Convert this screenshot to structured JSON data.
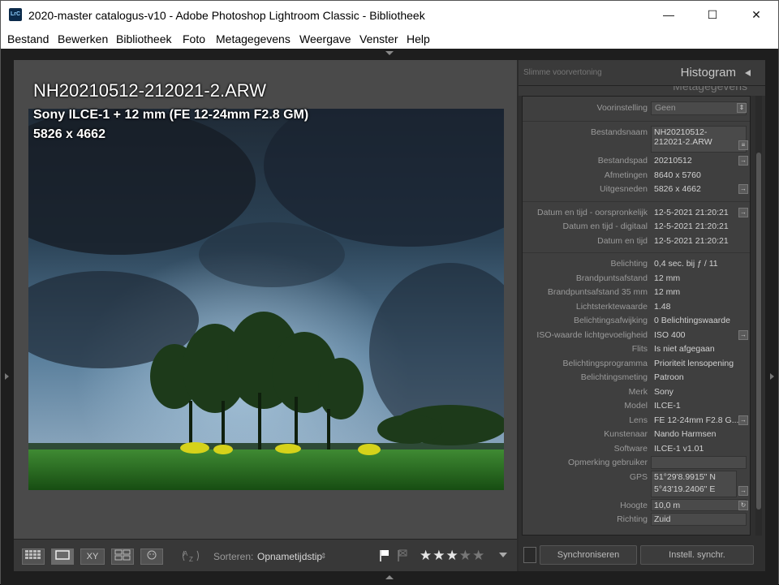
{
  "window": {
    "title": "2020-master catalogus-v10 - Adobe Photoshop Lightroom Classic - Bibliotheek",
    "app_icon": "LrC",
    "minimize": "—",
    "maximize": "☐",
    "close": "✕"
  },
  "menu": [
    "Bestand",
    "Bewerken",
    "Bibliotheek",
    "Foto",
    "Metagegevens",
    "Weergave",
    "Venster",
    "Help"
  ],
  "overlay": {
    "filename": "NH20210512-212021-2.ARW",
    "camera": "Sony ILCE-1 + 12 mm (FE 12-24mm F2.8 GM)",
    "dimensions": "5826 x 4662"
  },
  "toolbar": {
    "sort_label": "Sorteren:",
    "sort_value": "Opnametijdstip",
    "rating_stars": 3,
    "rating_max": 5,
    "xy_label": "XY"
  },
  "right_panel": {
    "smart_preview": "Slimme voorvertoning",
    "histogram": "Histogram",
    "metadata_header": "Metagegevens",
    "preset_label": "Voorinstelling",
    "preset_value": "Geen",
    "fields": [
      {
        "label": "Bestandsnaam",
        "value": "NH20210512-212021-2.ARW",
        "box": true
      },
      {
        "label": "Bestandspad",
        "value": "20210512",
        "arrow": true
      },
      {
        "label": "Afmetingen",
        "value": "8640 x 5760"
      },
      {
        "label": "Uitgesneden",
        "value": "5826 x 4662",
        "arrow": true
      },
      {
        "label": "Datum en tijd - oorspronkelijk",
        "value": "12-5-2021 21:20:21",
        "arrow": true
      },
      {
        "label": "Datum en tijd - digitaal",
        "value": "12-5-2021 21:20:21"
      },
      {
        "label": "Datum en tijd",
        "value": "12-5-2021 21:20:21"
      },
      {
        "label": "Belichting",
        "value": "0,4 sec. bij ƒ / 11"
      },
      {
        "label": "Brandpuntsafstand",
        "value": "12 mm"
      },
      {
        "label": "Brandpuntsafstand 35 mm",
        "value": "12 mm"
      },
      {
        "label": "Lichtsterktewaarde",
        "value": "1.48"
      },
      {
        "label": "Belichtingsafwijking",
        "value": "0 Belichtingswaarde"
      },
      {
        "label": "ISO-waarde lichtgevoeligheid",
        "value": "ISO 400",
        "arrow": true
      },
      {
        "label": "Flits",
        "value": "Is niet afgegaan"
      },
      {
        "label": "Belichtingsprogramma",
        "value": "Prioriteit lensopening"
      },
      {
        "label": "Belichtingsmeting",
        "value": "Patroon"
      },
      {
        "label": "Merk",
        "value": "Sony"
      },
      {
        "label": "Model",
        "value": "ILCE-1"
      },
      {
        "label": "Lens",
        "value": "FE 12-24mm F2.8 G...",
        "arrow": true
      },
      {
        "label": "Kunstenaar",
        "value": "Nando Harmsen"
      },
      {
        "label": "Software",
        "value": "ILCE-1 v1.01"
      },
      {
        "label": "Opmerking gebruiker",
        "value": "",
        "box": true
      },
      {
        "label": "GPS",
        "value": "51°29'8.9915\" N",
        "value2": "5°43'19.2406\" E",
        "box": true,
        "arrow": true
      },
      {
        "label": "Hoogte",
        "value": "10,0 m",
        "box": true
      },
      {
        "label": "Richting",
        "value": "Zuid",
        "box": true
      }
    ],
    "sync_button": "Synchroniseren",
    "settings_sync_button": "Instell. synchr."
  },
  "colors": {
    "panel_bg": "#2f2f2f",
    "meta_bg": "#3f3f3f",
    "viewer_bg": "#4a4a4a",
    "label": "#9a9a9a",
    "value": "#d2d2d2"
  }
}
